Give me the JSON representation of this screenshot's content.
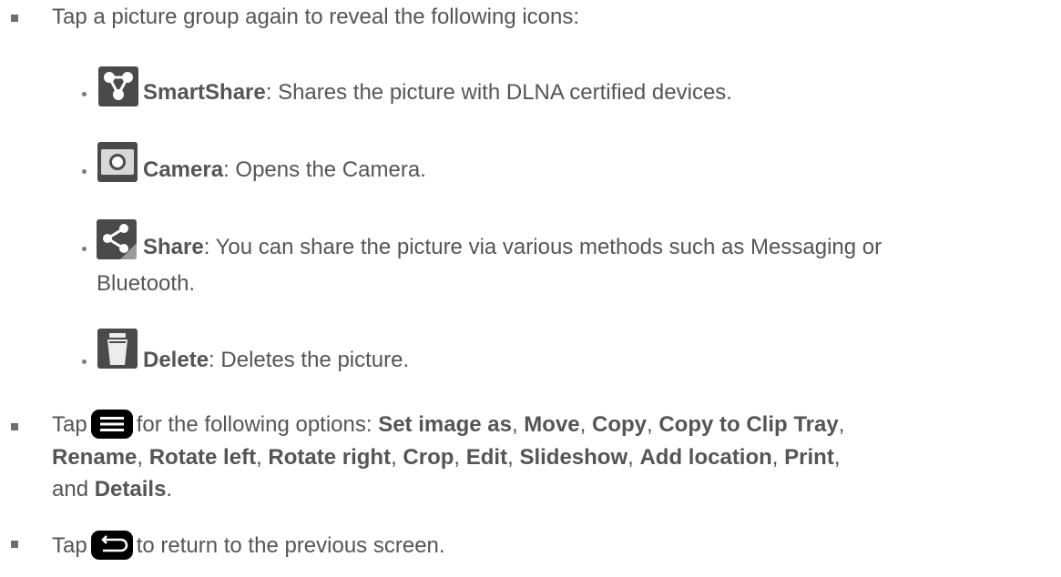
{
  "items": {
    "intro": "Tap a picture group again to reveal the following icons:",
    "smartshare": {
      "name": "SmartShare",
      "desc": ": Shares the picture with DLNA certified devices."
    },
    "camera": {
      "name": "Camera",
      "desc": ": Opens the Camera."
    },
    "share": {
      "name": "Share",
      "desc_1": ": You can share the picture via various methods such as Messaging or",
      "desc_2": "Bluetooth."
    },
    "delete": {
      "name": "Delete",
      "desc": ": Deletes the picture."
    }
  },
  "menu": {
    "pre": "Tap",
    "post": "for the following options:",
    "options": [
      "Set image as",
      "Move",
      "Copy",
      "Copy to Clip Tray",
      "Rename",
      "Rotate left",
      "Rotate right",
      "Crop",
      "Edit",
      "Slideshow",
      "Add location",
      "Print",
      "Details"
    ],
    "and_word": "and"
  },
  "back": {
    "pre": "Tap",
    "post": "to return to the previous screen."
  },
  "icons": {
    "smartshare": "smartshare-icon",
    "camera": "camera-icon",
    "share": "share-icon",
    "delete": "trash-icon",
    "menu": "menu-key-icon",
    "back": "back-key-icon"
  }
}
